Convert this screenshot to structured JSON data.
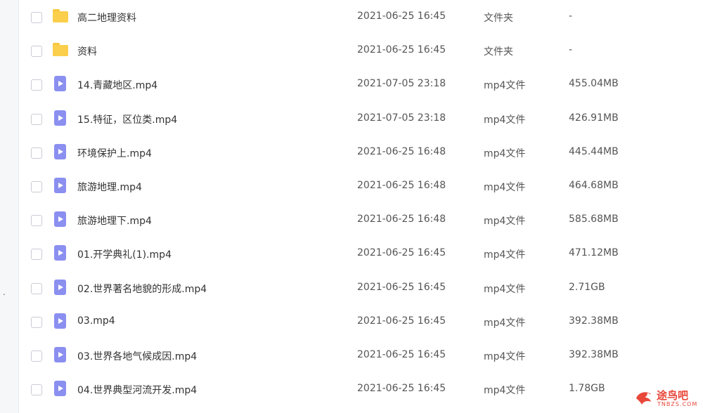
{
  "sidebar": {
    "marker": "."
  },
  "files": [
    {
      "name": "高二地理资料",
      "date": "2021-06-25 16:45",
      "type": "文件夹",
      "size": "-",
      "kind": "folder"
    },
    {
      "name": "资料",
      "date": "2021-06-25 16:45",
      "type": "文件夹",
      "size": "-",
      "kind": "folder"
    },
    {
      "name": "14.青藏地区.mp4",
      "date": "2021-07-05 23:18",
      "type": "mp4文件",
      "size": "455.04MB",
      "kind": "video"
    },
    {
      "name": "15.特征，区位类.mp4",
      "date": "2021-07-05 23:18",
      "type": "mp4文件",
      "size": "426.91MB",
      "kind": "video"
    },
    {
      "name": "环境保护上.mp4",
      "date": "2021-06-25 16:48",
      "type": "mp4文件",
      "size": "445.44MB",
      "kind": "video"
    },
    {
      "name": "旅游地理.mp4",
      "date": "2021-06-25 16:48",
      "type": "mp4文件",
      "size": "464.68MB",
      "kind": "video"
    },
    {
      "name": "旅游地理下.mp4",
      "date": "2021-06-25 16:48",
      "type": "mp4文件",
      "size": "585.68MB",
      "kind": "video"
    },
    {
      "name": "01.开学典礼(1).mp4",
      "date": "2021-06-25 16:45",
      "type": "mp4文件",
      "size": "471.12MB",
      "kind": "video"
    },
    {
      "name": "02.世界著名地貌的形成.mp4",
      "date": "2021-06-25 16:45",
      "type": "mp4文件",
      "size": "2.71GB",
      "kind": "video"
    },
    {
      "name": "03.mp4",
      "date": "2021-06-25 16:45",
      "type": "mp4文件",
      "size": "392.38MB",
      "kind": "video"
    },
    {
      "name": "03.世界各地气候成因.mp4",
      "date": "2021-06-25 16:45",
      "type": "mp4文件",
      "size": "392.38MB",
      "kind": "video"
    },
    {
      "name": "04.世界典型河流开发.mp4",
      "date": "2021-06-25 16:45",
      "type": "mp4文件",
      "size": "1.78GB",
      "kind": "video"
    }
  ],
  "watermark": {
    "text": "途鸟吧",
    "sub": "TNBZS.COM"
  }
}
